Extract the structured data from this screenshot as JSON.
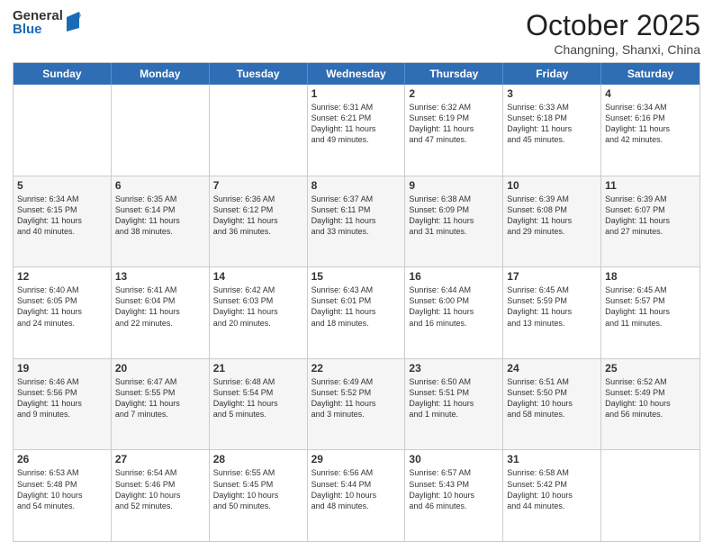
{
  "header": {
    "logo_general": "General",
    "logo_blue": "Blue",
    "month_title": "October 2025",
    "subtitle": "Changning, Shanxi, China"
  },
  "weekdays": [
    "Sunday",
    "Monday",
    "Tuesday",
    "Wednesday",
    "Thursday",
    "Friday",
    "Saturday"
  ],
  "rows": [
    [
      {
        "day": "",
        "text": ""
      },
      {
        "day": "",
        "text": ""
      },
      {
        "day": "",
        "text": ""
      },
      {
        "day": "1",
        "text": "Sunrise: 6:31 AM\nSunset: 6:21 PM\nDaylight: 11 hours\nand 49 minutes."
      },
      {
        "day": "2",
        "text": "Sunrise: 6:32 AM\nSunset: 6:19 PM\nDaylight: 11 hours\nand 47 minutes."
      },
      {
        "day": "3",
        "text": "Sunrise: 6:33 AM\nSunset: 6:18 PM\nDaylight: 11 hours\nand 45 minutes."
      },
      {
        "day": "4",
        "text": "Sunrise: 6:34 AM\nSunset: 6:16 PM\nDaylight: 11 hours\nand 42 minutes."
      }
    ],
    [
      {
        "day": "5",
        "text": "Sunrise: 6:34 AM\nSunset: 6:15 PM\nDaylight: 11 hours\nand 40 minutes."
      },
      {
        "day": "6",
        "text": "Sunrise: 6:35 AM\nSunset: 6:14 PM\nDaylight: 11 hours\nand 38 minutes."
      },
      {
        "day": "7",
        "text": "Sunrise: 6:36 AM\nSunset: 6:12 PM\nDaylight: 11 hours\nand 36 minutes."
      },
      {
        "day": "8",
        "text": "Sunrise: 6:37 AM\nSunset: 6:11 PM\nDaylight: 11 hours\nand 33 minutes."
      },
      {
        "day": "9",
        "text": "Sunrise: 6:38 AM\nSunset: 6:09 PM\nDaylight: 11 hours\nand 31 minutes."
      },
      {
        "day": "10",
        "text": "Sunrise: 6:39 AM\nSunset: 6:08 PM\nDaylight: 11 hours\nand 29 minutes."
      },
      {
        "day": "11",
        "text": "Sunrise: 6:39 AM\nSunset: 6:07 PM\nDaylight: 11 hours\nand 27 minutes."
      }
    ],
    [
      {
        "day": "12",
        "text": "Sunrise: 6:40 AM\nSunset: 6:05 PM\nDaylight: 11 hours\nand 24 minutes."
      },
      {
        "day": "13",
        "text": "Sunrise: 6:41 AM\nSunset: 6:04 PM\nDaylight: 11 hours\nand 22 minutes."
      },
      {
        "day": "14",
        "text": "Sunrise: 6:42 AM\nSunset: 6:03 PM\nDaylight: 11 hours\nand 20 minutes."
      },
      {
        "day": "15",
        "text": "Sunrise: 6:43 AM\nSunset: 6:01 PM\nDaylight: 11 hours\nand 18 minutes."
      },
      {
        "day": "16",
        "text": "Sunrise: 6:44 AM\nSunset: 6:00 PM\nDaylight: 11 hours\nand 16 minutes."
      },
      {
        "day": "17",
        "text": "Sunrise: 6:45 AM\nSunset: 5:59 PM\nDaylight: 11 hours\nand 13 minutes."
      },
      {
        "day": "18",
        "text": "Sunrise: 6:45 AM\nSunset: 5:57 PM\nDaylight: 11 hours\nand 11 minutes."
      }
    ],
    [
      {
        "day": "19",
        "text": "Sunrise: 6:46 AM\nSunset: 5:56 PM\nDaylight: 11 hours\nand 9 minutes."
      },
      {
        "day": "20",
        "text": "Sunrise: 6:47 AM\nSunset: 5:55 PM\nDaylight: 11 hours\nand 7 minutes."
      },
      {
        "day": "21",
        "text": "Sunrise: 6:48 AM\nSunset: 5:54 PM\nDaylight: 11 hours\nand 5 minutes."
      },
      {
        "day": "22",
        "text": "Sunrise: 6:49 AM\nSunset: 5:52 PM\nDaylight: 11 hours\nand 3 minutes."
      },
      {
        "day": "23",
        "text": "Sunrise: 6:50 AM\nSunset: 5:51 PM\nDaylight: 11 hours\nand 1 minute."
      },
      {
        "day": "24",
        "text": "Sunrise: 6:51 AM\nSunset: 5:50 PM\nDaylight: 10 hours\nand 58 minutes."
      },
      {
        "day": "25",
        "text": "Sunrise: 6:52 AM\nSunset: 5:49 PM\nDaylight: 10 hours\nand 56 minutes."
      }
    ],
    [
      {
        "day": "26",
        "text": "Sunrise: 6:53 AM\nSunset: 5:48 PM\nDaylight: 10 hours\nand 54 minutes."
      },
      {
        "day": "27",
        "text": "Sunrise: 6:54 AM\nSunset: 5:46 PM\nDaylight: 10 hours\nand 52 minutes."
      },
      {
        "day": "28",
        "text": "Sunrise: 6:55 AM\nSunset: 5:45 PM\nDaylight: 10 hours\nand 50 minutes."
      },
      {
        "day": "29",
        "text": "Sunrise: 6:56 AM\nSunset: 5:44 PM\nDaylight: 10 hours\nand 48 minutes."
      },
      {
        "day": "30",
        "text": "Sunrise: 6:57 AM\nSunset: 5:43 PM\nDaylight: 10 hours\nand 46 minutes."
      },
      {
        "day": "31",
        "text": "Sunrise: 6:58 AM\nSunset: 5:42 PM\nDaylight: 10 hours\nand 44 minutes."
      },
      {
        "day": "",
        "text": ""
      }
    ]
  ]
}
